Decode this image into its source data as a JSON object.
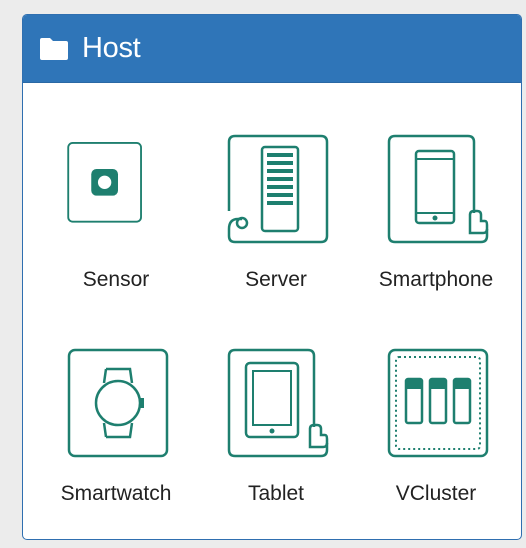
{
  "panel": {
    "title": "Host",
    "header_color": "#2f75b8",
    "icon": "folder-icon"
  },
  "colors": {
    "accent": "#1e7f6f"
  },
  "hosts": [
    {
      "label": "Sensor",
      "icon": "sensor-icon"
    },
    {
      "label": "Server",
      "icon": "server-icon"
    },
    {
      "label": "Smartphone",
      "icon": "smartphone-icon"
    },
    {
      "label": "Smartwatch",
      "icon": "smartwatch-icon"
    },
    {
      "label": "Tablet",
      "icon": "tablet-icon"
    },
    {
      "label": "VCluster",
      "icon": "vcluster-icon"
    }
  ]
}
